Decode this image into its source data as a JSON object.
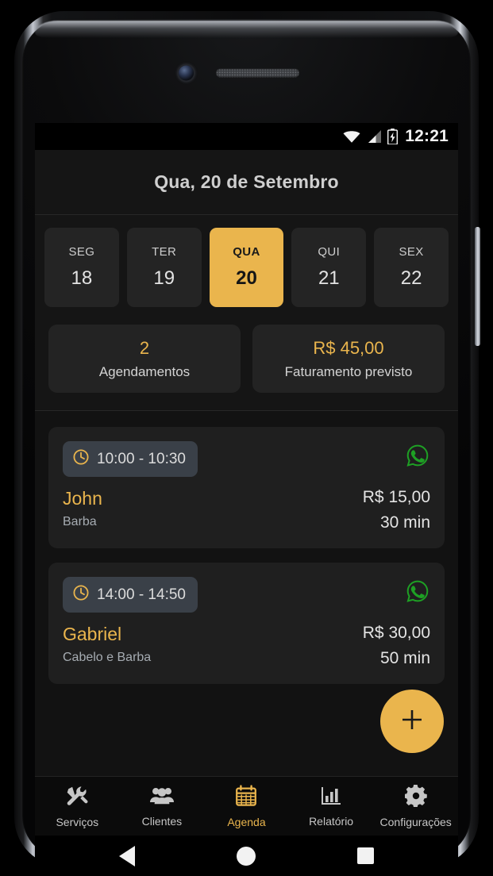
{
  "statusbar": {
    "time": "12:21",
    "wifi_icon": "wifi-icon",
    "signal_icon": "cellular-signal-icon",
    "battery_icon": "battery-charging-icon"
  },
  "header": {
    "title": "Qua, 20 de Setembro"
  },
  "week_strip": {
    "days": [
      {
        "dow": "SEG",
        "num": "18",
        "active": false
      },
      {
        "dow": "TER",
        "num": "19",
        "active": false
      },
      {
        "dow": "QUA",
        "num": "20",
        "active": true
      },
      {
        "dow": "QUI",
        "num": "21",
        "active": false
      },
      {
        "dow": "SEX",
        "num": "22",
        "active": false
      }
    ]
  },
  "stats": [
    {
      "value": "2",
      "label": "Agendamentos"
    },
    {
      "value": "R$ 45,00",
      "label": "Faturamento previsto"
    }
  ],
  "appointments": [
    {
      "time": "10:00 - 10:30",
      "name": "John",
      "service": "Barba",
      "price": "R$ 15,00",
      "duration": "30 min",
      "clock_icon": "clock-icon",
      "contact_icon": "whatsapp-icon"
    },
    {
      "time": "14:00 - 14:50",
      "name": "Gabriel",
      "service": "Cabelo e Barba",
      "price": "R$ 30,00",
      "duration": "50 min",
      "clock_icon": "clock-icon",
      "contact_icon": "whatsapp-icon"
    }
  ],
  "fab": {
    "icon": "plus-icon",
    "label": "+"
  },
  "bottom_nav": {
    "items": [
      {
        "label": "Serviços",
        "icon": "tools-icon",
        "active": false
      },
      {
        "label": "Clientes",
        "icon": "people-group-icon",
        "active": false
      },
      {
        "label": "Agenda",
        "icon": "calendar-icon",
        "active": true
      },
      {
        "label": "Relatório",
        "icon": "bar-chart-icon",
        "active": false
      },
      {
        "label": "Configurações",
        "icon": "gear-icon",
        "active": false
      }
    ]
  },
  "android_nav": {
    "back": "back-triangle-icon",
    "home": "home-circle-icon",
    "recents": "recents-square-icon"
  },
  "colors": {
    "accent": "#EAB54D",
    "whatsapp_green": "#1EA024",
    "screen_bg": "#121212",
    "card_bg": "#1F1F1F",
    "chip_bg": "#3A4048"
  }
}
